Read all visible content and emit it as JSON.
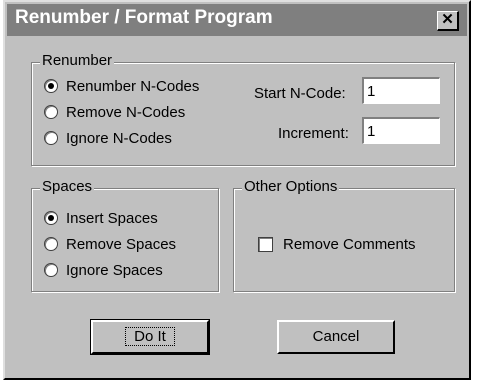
{
  "dialog": {
    "title": "Renumber / Format Program",
    "close_glyph": "✕"
  },
  "renumber": {
    "title": "Renumber",
    "options": [
      {
        "label": "Renumber N-Codes",
        "selected": true
      },
      {
        "label": "Remove N-Codes",
        "selected": false
      },
      {
        "label": "Ignore N-Codes",
        "selected": false
      }
    ],
    "start_label": "Start N-Code:",
    "start_value": "1",
    "increment_label": "Increment:",
    "increment_value": "1"
  },
  "spaces": {
    "title": "Spaces",
    "options": [
      {
        "label": "Insert Spaces",
        "selected": true
      },
      {
        "label": "Remove Spaces",
        "selected": false
      },
      {
        "label": "Ignore Spaces",
        "selected": false
      }
    ]
  },
  "other": {
    "title": "Other Options",
    "remove_comments_label": "Remove Comments",
    "remove_comments_checked": false
  },
  "buttons": {
    "do_it": "Do It",
    "cancel": "Cancel"
  }
}
